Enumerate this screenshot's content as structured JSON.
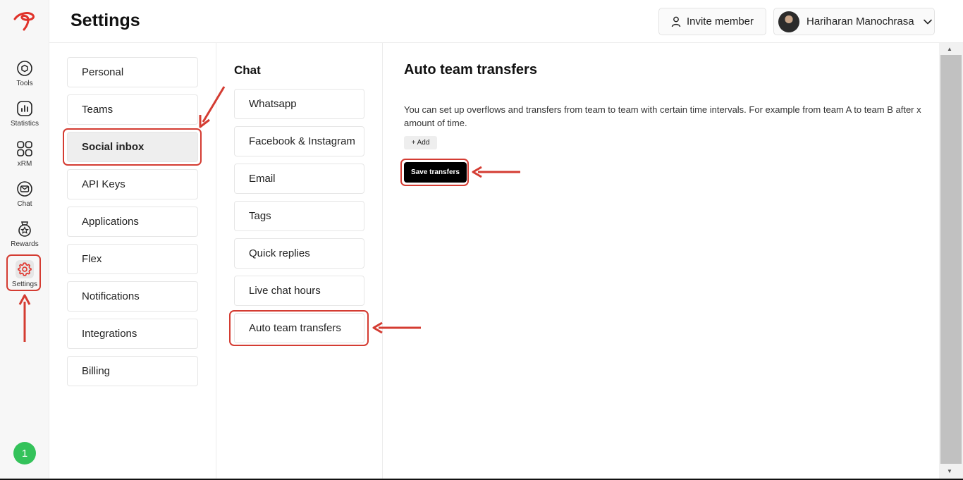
{
  "header": {
    "title": "Settings",
    "invite_label": "Invite member",
    "user_name": "Hariharan Manochrasa"
  },
  "rail": {
    "items": [
      {
        "label": "Tools",
        "icon": "tools-icon"
      },
      {
        "label": "Statistics",
        "icon": "statistics-icon"
      },
      {
        "label": "xRM",
        "icon": "grid-icon"
      },
      {
        "label": "Chat",
        "icon": "chat-icon"
      },
      {
        "label": "Rewards",
        "icon": "rewards-icon"
      },
      {
        "label": "Settings",
        "icon": "gear-icon"
      }
    ],
    "badge": "1"
  },
  "settings_nav": {
    "items": [
      "Personal",
      "Teams",
      "Social inbox",
      "API Keys",
      "Applications",
      "Flex",
      "Notifications",
      "Integrations",
      "Billing"
    ],
    "selected": "Social inbox"
  },
  "chat_nav": {
    "heading": "Chat",
    "items": [
      "Whatsapp",
      "Facebook & Instagram",
      "Email",
      "Tags",
      "Quick replies",
      "Live chat hours",
      "Auto team transfers"
    ]
  },
  "content": {
    "title": "Auto team transfers",
    "description": "You can set up overflows and transfers from team to team with certain time intervals. For example from team A to team B after x amount of time.",
    "add_label": "+ Add",
    "save_label": "Save transfers"
  },
  "colors": {
    "annotation": "#d43c32",
    "badge": "#34c25a",
    "brand": "#e0322a"
  }
}
